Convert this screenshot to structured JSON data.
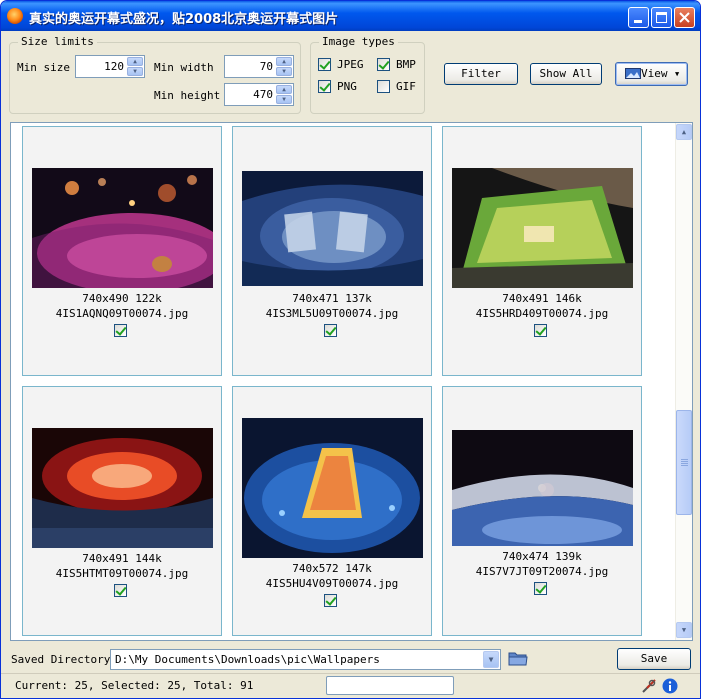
{
  "window": {
    "title": "真实的奥运开幕式盛况，贴2008北京奥运开幕式图片"
  },
  "size_limits": {
    "group_title": "Size limits",
    "min_size_label": "Min size",
    "min_size_value": "120",
    "min_width_label": "Min width",
    "min_width_value": "70",
    "min_height_label": "Min height",
    "min_height_value": "470"
  },
  "image_types": {
    "group_title": "Image types",
    "types": [
      {
        "label": "JPEG",
        "checked": true
      },
      {
        "label": "BMP",
        "checked": true
      },
      {
        "label": "PNG",
        "checked": true
      },
      {
        "label": "GIF",
        "checked": false
      }
    ]
  },
  "toolbar": {
    "filter_label": "Filter",
    "show_all_label": "Show All",
    "view_label": "View"
  },
  "thumbnails": [
    {
      "dims": "740x490",
      "size": "122k",
      "filename": "4IS1AQNQ09T00074.jpg",
      "checked": true
    },
    {
      "dims": "740x471",
      "size": "137k",
      "filename": "4IS3ML5U09T00074.jpg",
      "checked": true
    },
    {
      "dims": "740x491",
      "size": "146k",
      "filename": "4IS5HRD409T00074.jpg",
      "checked": true
    },
    {
      "dims": "740x491",
      "size": "144k",
      "filename": "4IS5HTMT09T00074.jpg",
      "checked": true
    },
    {
      "dims": "740x572",
      "size": "147k",
      "filename": "4IS5HU4V09T00074.jpg",
      "checked": true
    },
    {
      "dims": "740x474",
      "size": "139k",
      "filename": "4IS7V7JT09T20074.jpg",
      "checked": true
    }
  ],
  "bottom": {
    "saved_directory_label": "Saved Directory",
    "saved_directory_value": "D:\\My Documents\\Downloads\\pic\\Wallpapers",
    "save_label": "Save"
  },
  "status": {
    "text": "Current: 25, Selected: 25, Total: 91"
  },
  "icons": {
    "app": "app-icon",
    "minimize": "minimize-icon",
    "maximize": "maximize-icon",
    "close": "close-icon",
    "folder": "folder-icon",
    "tools": "tools-icon",
    "info": "info-icon"
  }
}
